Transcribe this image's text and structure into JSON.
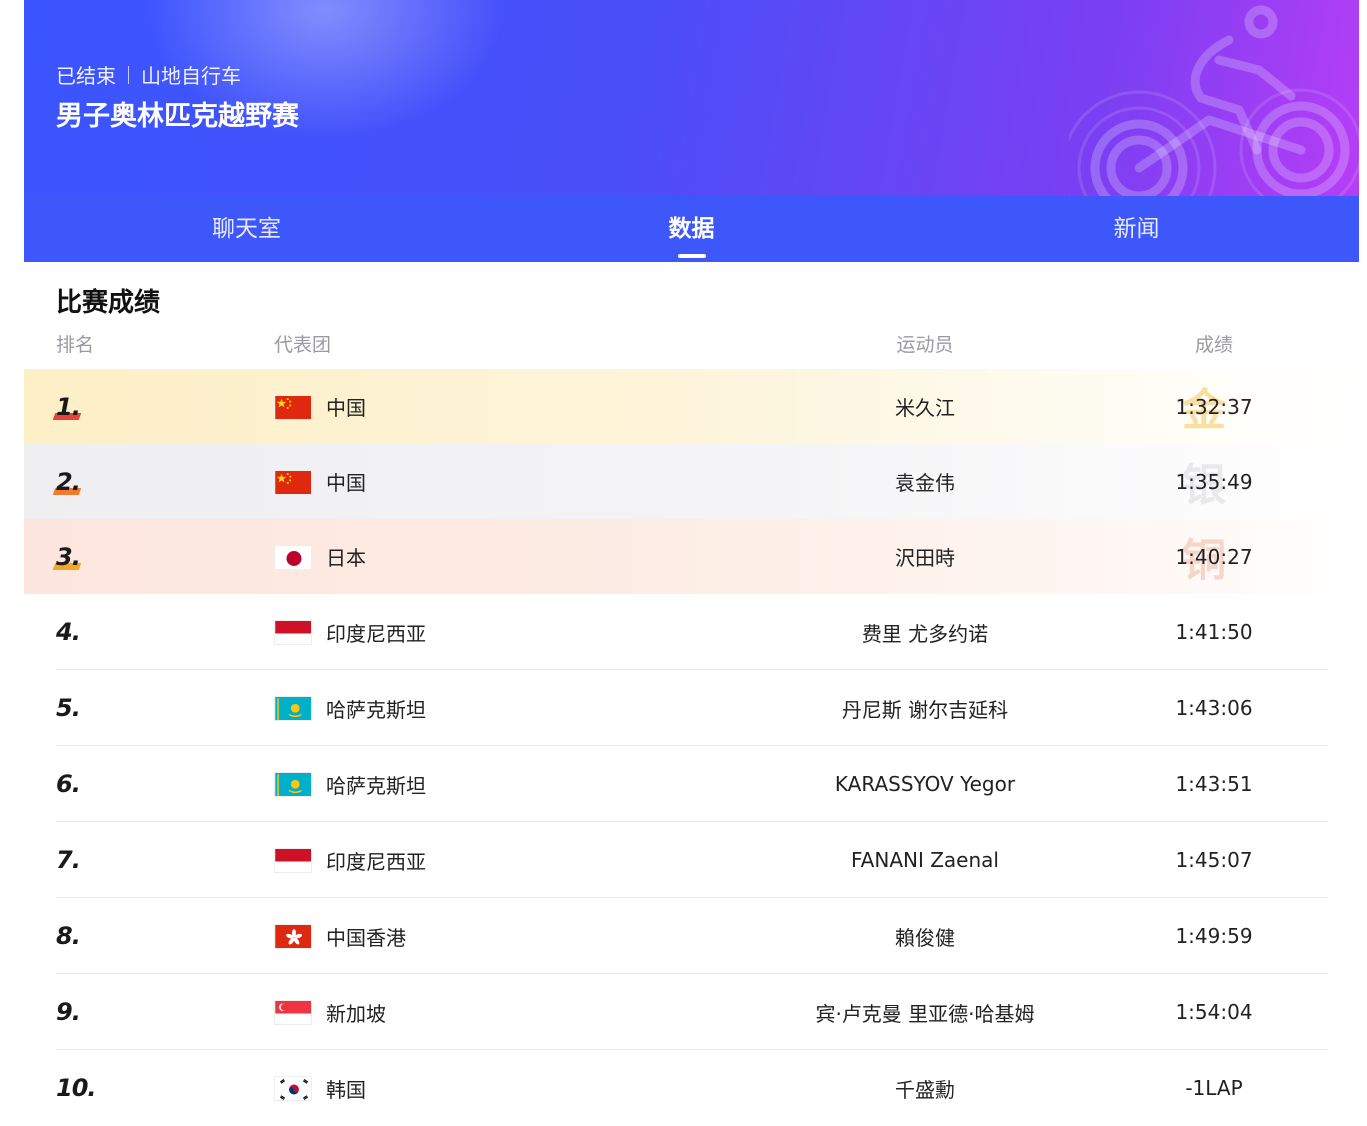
{
  "header": {
    "status": "已结束",
    "sport": "山地自行车",
    "event_title": "男子奥林匹克越野赛"
  },
  "tabs": [
    {
      "label": "聊天室",
      "active": false
    },
    {
      "label": "数据",
      "active": true
    },
    {
      "label": "新闻",
      "active": false
    }
  ],
  "results": {
    "section_title": "比赛成绩",
    "columns": {
      "rank": "排名",
      "team": "代表团",
      "athlete": "运动员",
      "result": "成绩"
    },
    "medal_labels": {
      "gold": "金",
      "silver": "银",
      "bronze": "铜"
    },
    "rows": [
      {
        "rank": "1.",
        "flag": "china-flag",
        "team": "中国",
        "athlete": "米久江",
        "result": "1:32:37"
      },
      {
        "rank": "2.",
        "flag": "china-flag",
        "team": "中国",
        "athlete": "袁金伟",
        "result": "1:35:49"
      },
      {
        "rank": "3.",
        "flag": "japan-flag",
        "team": "日本",
        "athlete": "沢田時",
        "result": "1:40:27"
      },
      {
        "rank": "4.",
        "flag": "indonesia-flag",
        "team": "印度尼西亚",
        "athlete": "费里 尤多约诺",
        "result": "1:41:50"
      },
      {
        "rank": "5.",
        "flag": "kazakhstan-flag",
        "team": "哈萨克斯坦",
        "athlete": "丹尼斯 谢尔吉延科",
        "result": "1:43:06"
      },
      {
        "rank": "6.",
        "flag": "kazakhstan-flag",
        "team": "哈萨克斯坦",
        "athlete": "KARASSYOV Yegor",
        "result": "1:43:51"
      },
      {
        "rank": "7.",
        "flag": "indonesia-flag",
        "team": "印度尼西亚",
        "athlete": "FANANI Zaenal",
        "result": "1:45:07"
      },
      {
        "rank": "8.",
        "flag": "hongkong-flag",
        "team": "中国香港",
        "athlete": "賴俊健",
        "result": "1:49:59"
      },
      {
        "rank": "9.",
        "flag": "singapore-flag",
        "team": "新加坡",
        "athlete": "宾·卢克曼 里亚德·哈基姆",
        "result": "1:54:04"
      },
      {
        "rank": "10.",
        "flag": "korea-flag",
        "team": "韩国",
        "athlete": "千盛勳",
        "result": "-1LAP"
      }
    ]
  },
  "colors": {
    "header_start": "#3a55ff",
    "header_end": "#b63ef6",
    "tab_bar": "#3d57fb",
    "gold_bar": "#e8433b",
    "silver_bar": "#f07a2d",
    "bronze_bar": "#f5a623"
  }
}
